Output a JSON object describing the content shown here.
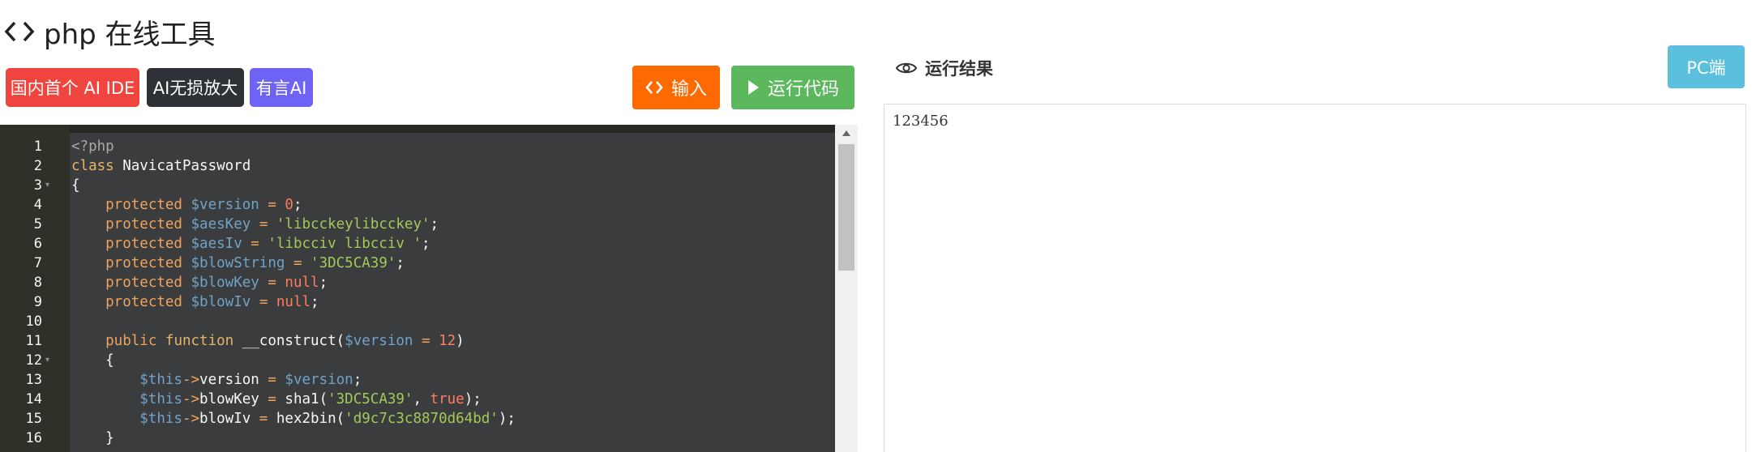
{
  "header": {
    "title": "php 在线工具",
    "icon": "code-brackets-icon"
  },
  "tags": [
    {
      "label": "国内首个 AI IDE",
      "color": "#f0443f"
    },
    {
      "label": "AI无损放大",
      "color": "#2e3136"
    },
    {
      "label": "有言AI",
      "color": "#6d63f5"
    }
  ],
  "toolbar": {
    "input_label": "输入",
    "run_label": "运行代码",
    "input_color": "#ff6a00",
    "run_color": "#5cb85c"
  },
  "result": {
    "title": "运行结果",
    "icon": "eye-icon",
    "pc_label": "PC端",
    "output": "123456"
  },
  "editor": {
    "line_numbers": [
      "1",
      "2",
      "3",
      "4",
      "5",
      "6",
      "7",
      "8",
      "9",
      "10",
      "11",
      "12",
      "13",
      "14",
      "15",
      "16"
    ],
    "foldable_lines": [
      3,
      12
    ],
    "lines": [
      [
        [
          "c-tag",
          "<?php"
        ]
      ],
      [
        [
          "c-kw",
          "class "
        ],
        [
          "c-plain",
          "NavicatPassword"
        ]
      ],
      [
        [
          "c-plain",
          "{"
        ]
      ],
      [
        [
          "c-kw2",
          "    protected "
        ],
        [
          "c-var",
          "$version"
        ],
        [
          "c-op",
          " = "
        ],
        [
          "c-num",
          "0"
        ],
        [
          "c-plain",
          ";"
        ]
      ],
      [
        [
          "c-kw2",
          "    protected "
        ],
        [
          "c-var",
          "$aesKey"
        ],
        [
          "c-op",
          " = "
        ],
        [
          "c-str",
          "'libcckeylibcckey'"
        ],
        [
          "c-plain",
          ";"
        ]
      ],
      [
        [
          "c-kw2",
          "    protected "
        ],
        [
          "c-var",
          "$aesIv"
        ],
        [
          "c-op",
          " = "
        ],
        [
          "c-str",
          "'libcciv libcciv '"
        ],
        [
          "c-plain",
          ";"
        ]
      ],
      [
        [
          "c-kw2",
          "    protected "
        ],
        [
          "c-var",
          "$blowString"
        ],
        [
          "c-op",
          " = "
        ],
        [
          "c-str",
          "'3DC5CA39'"
        ],
        [
          "c-plain",
          ";"
        ]
      ],
      [
        [
          "c-kw2",
          "    protected "
        ],
        [
          "c-var",
          "$blowKey"
        ],
        [
          "c-op",
          " = "
        ],
        [
          "c-num",
          "null"
        ],
        [
          "c-plain",
          ";"
        ]
      ],
      [
        [
          "c-kw2",
          "    protected "
        ],
        [
          "c-var",
          "$blowIv"
        ],
        [
          "c-op",
          " = "
        ],
        [
          "c-num",
          "null"
        ],
        [
          "c-plain",
          ";"
        ]
      ],
      [],
      [
        [
          "c-kw2",
          "    public "
        ],
        [
          "c-kw",
          "function "
        ],
        [
          "c-fn",
          "__construct("
        ],
        [
          "c-var",
          "$version"
        ],
        [
          "c-op",
          " = "
        ],
        [
          "c-num",
          "12"
        ],
        [
          "c-plain",
          ")"
        ]
      ],
      [
        [
          "c-plain",
          "    {"
        ]
      ],
      [
        [
          "c-var",
          "        $this"
        ],
        [
          "c-op",
          "->"
        ],
        [
          "c-plain",
          "version"
        ],
        [
          "c-op",
          " = "
        ],
        [
          "c-var",
          "$version"
        ],
        [
          "c-plain",
          ";"
        ]
      ],
      [
        [
          "c-var",
          "        $this"
        ],
        [
          "c-op",
          "->"
        ],
        [
          "c-plain",
          "blowKey"
        ],
        [
          "c-op",
          " = "
        ],
        [
          "c-fn",
          "sha1("
        ],
        [
          "c-str",
          "'3DC5CA39'"
        ],
        [
          "c-plain",
          ", "
        ],
        [
          "c-num",
          "true"
        ],
        [
          "c-plain",
          ");"
        ]
      ],
      [
        [
          "c-var",
          "        $this"
        ],
        [
          "c-op",
          "->"
        ],
        [
          "c-plain",
          "blowIv"
        ],
        [
          "c-op",
          " = "
        ],
        [
          "c-fn",
          "hex2bin("
        ],
        [
          "c-str",
          "'d9c7c3c8870d64bd'"
        ],
        [
          "c-plain",
          ");"
        ]
      ],
      [
        [
          "c-plain",
          "    }"
        ]
      ]
    ]
  }
}
